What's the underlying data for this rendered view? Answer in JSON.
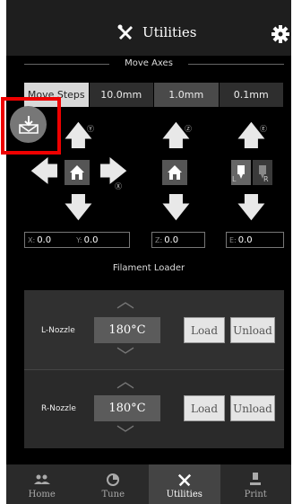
{
  "header": {
    "title": "Utilities",
    "utility_icon": "tools-icon",
    "settings_icon": "gear-icon"
  },
  "move_axes": {
    "section_title": "Move Axes",
    "steps": {
      "label": "Move Steps",
      "options": [
        "10.0mm",
        "1.0mm",
        "0.1mm"
      ],
      "selected": "1.0mm"
    },
    "axis_markers": {
      "y": "Ⓨ",
      "x": "Ⓧ",
      "z": "Ⓩ",
      "e": "Ⓔ"
    },
    "extruder_labels": {
      "l": "L",
      "r": "R"
    },
    "readouts": {
      "x": {
        "axis": "X:",
        "value": "0.0"
      },
      "y": {
        "axis": "Y:",
        "value": "0.0"
      },
      "z": {
        "axis": "Z:",
        "value": "0.0"
      },
      "e": {
        "axis": "E:",
        "value": "0.0"
      }
    }
  },
  "overlay": {
    "icon": "download-tray-icon",
    "highlight_color": "#e00000"
  },
  "filament": {
    "section_title": "Filament Loader",
    "nozzles": [
      {
        "label": "L-Nozzle",
        "temp": "180°C",
        "load": "Load",
        "unload": "Unload"
      },
      {
        "label": "R-Nozzle",
        "temp": "180°C",
        "load": "Load",
        "unload": "Unload"
      }
    ]
  },
  "tabs": [
    {
      "label": "Home",
      "icon": "people-icon"
    },
    {
      "label": "Tune",
      "icon": "pie-icon"
    },
    {
      "label": "Utilities",
      "icon": "tools-icon",
      "active": true
    },
    {
      "label": "Print",
      "icon": "print-icon"
    }
  ]
}
